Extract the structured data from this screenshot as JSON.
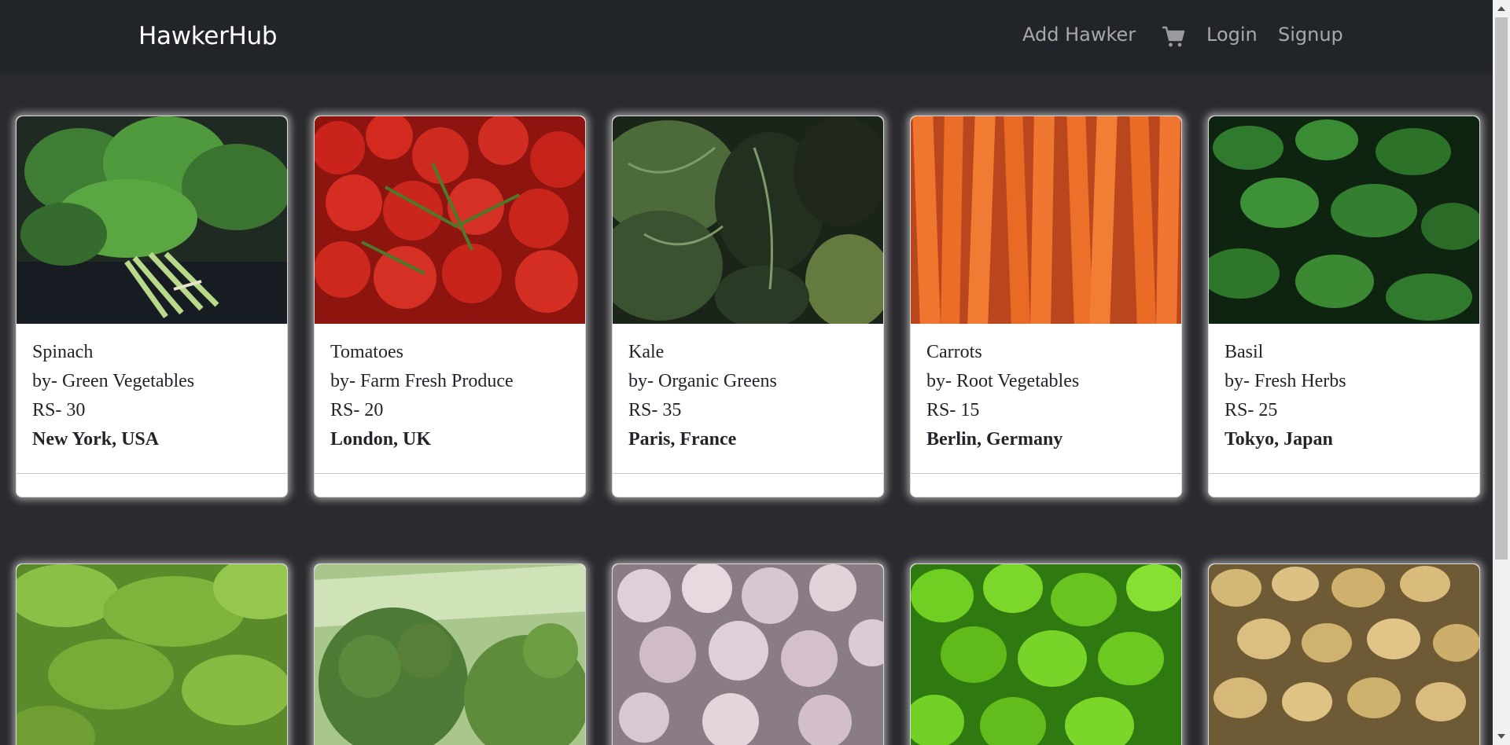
{
  "navbar": {
    "brand": "HawkerHub",
    "add_hawker": "Add Hawker",
    "cart_icon": "cart-icon",
    "login": "Login",
    "signup": "Signup"
  },
  "colors": {
    "navbar_bg": "#212529",
    "page_bg": "#2b2b2f",
    "card_bg": "#ffffff",
    "nav_text": "rgba(255,255,255,0.6)"
  },
  "products": [
    {
      "name": "Spinach",
      "vendor": "by- Green Vegetables",
      "price": "RS- 30",
      "location": "New York, USA",
      "image": "spinach-image"
    },
    {
      "name": "Tomatoes",
      "vendor": "by- Farm Fresh Produce",
      "price": "RS- 20",
      "location": "London, UK",
      "image": "tomatoes-image"
    },
    {
      "name": "Kale",
      "vendor": "by- Organic Greens",
      "price": "RS- 35",
      "location": "Paris, France",
      "image": "kale-image"
    },
    {
      "name": "Carrots",
      "vendor": "by- Root Vegetables",
      "price": "RS- 15",
      "location": "Berlin, Germany",
      "image": "carrots-image"
    },
    {
      "name": "Basil",
      "vendor": "by- Fresh Herbs",
      "price": "RS- 25",
      "location": "Tokyo, Japan",
      "image": "basil-image"
    }
  ],
  "second_row_images": [
    "lettuce-image",
    "broccoli-image",
    "garlic-image",
    "green-peppers-image",
    "potatoes-image"
  ]
}
